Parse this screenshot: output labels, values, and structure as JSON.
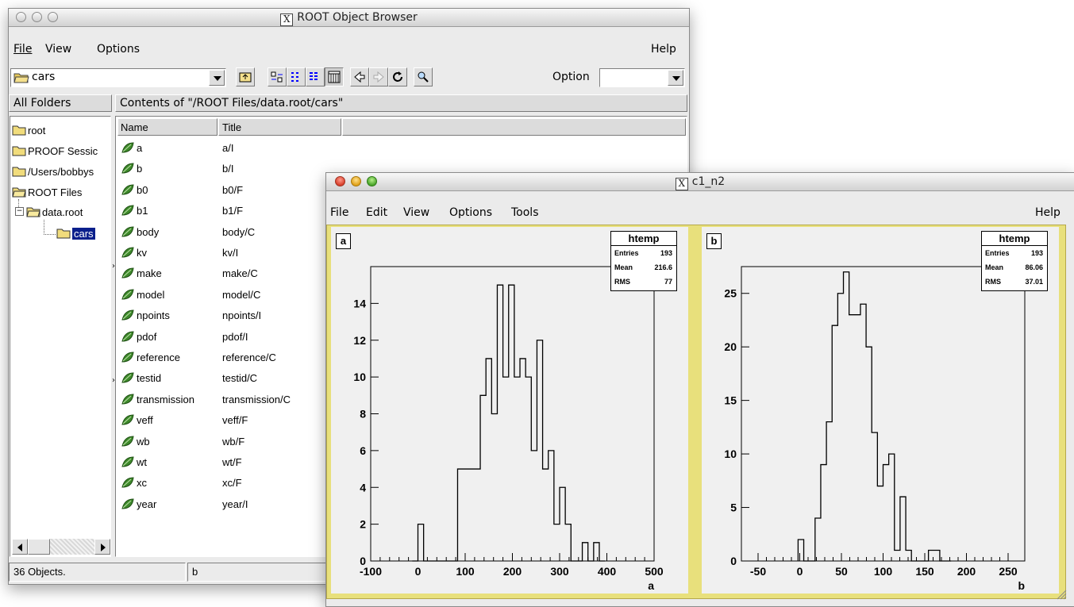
{
  "browser": {
    "title": "ROOT Object Browser",
    "menu": {
      "file": "File",
      "view": "View",
      "options": "Options",
      "help": "Help"
    },
    "location": "cars",
    "option_label": "Option",
    "option_value": "",
    "all_folders_label": "All Folders",
    "contents_label": "Contents of \"/ROOT Files/data.root/cars\"",
    "columns": {
      "name": "Name",
      "title": "Title"
    },
    "tree": [
      {
        "label": "root"
      },
      {
        "label": "PROOF Sessic"
      },
      {
        "label": "/Users/bobbys"
      },
      {
        "label": "ROOT Files"
      },
      {
        "label": "data.root"
      },
      {
        "label": "cars"
      }
    ],
    "items": [
      {
        "name": "a",
        "title": "a/I"
      },
      {
        "name": "b",
        "title": "b/I"
      },
      {
        "name": "b0",
        "title": "b0/F"
      },
      {
        "name": "b1",
        "title": "b1/F"
      },
      {
        "name": "body",
        "title": "body/C"
      },
      {
        "name": "kv",
        "title": "kv/I"
      },
      {
        "name": "make",
        "title": "make/C"
      },
      {
        "name": "model",
        "title": "model/C"
      },
      {
        "name": "npoints",
        "title": "npoints/I"
      },
      {
        "name": "pdof",
        "title": "pdof/I"
      },
      {
        "name": "reference",
        "title": "reference/C"
      },
      {
        "name": "testid",
        "title": "testid/C"
      },
      {
        "name": "transmission",
        "title": "transmission/C"
      },
      {
        "name": "veff",
        "title": "veff/F"
      },
      {
        "name": "wb",
        "title": "wb/F"
      },
      {
        "name": "wt",
        "title": "wt/F"
      },
      {
        "name": "xc",
        "title": "xc/F"
      },
      {
        "name": "year",
        "title": "year/I"
      }
    ],
    "status_count": "36 Objects.",
    "status_selected": "b"
  },
  "canvas": {
    "title": "c1_n2",
    "menu": {
      "file": "File",
      "edit": "Edit",
      "view": "View",
      "options": "Options",
      "tools": "Tools",
      "help": "Help"
    },
    "pad_a": {
      "label": "a",
      "stats": {
        "name": "htemp",
        "entries_label": "Entries",
        "entries": "193",
        "mean_label": "Mean",
        "mean": "216.6",
        "rms_label": "RMS",
        "rms": "77"
      }
    },
    "pad_b": {
      "label": "b",
      "stats": {
        "name": "htemp",
        "entries_label": "Entries",
        "entries": "193",
        "mean_label": "Mean",
        "mean": "86.06",
        "rms_label": "RMS",
        "rms": "37.01"
      }
    }
  },
  "chart_data": [
    {
      "type": "histogram",
      "xlabel": "a",
      "xlim": [
        -100,
        500
      ],
      "ylim": [
        0,
        16
      ],
      "xticks": [
        -100,
        0,
        100,
        200,
        300,
        400,
        500
      ],
      "yticks": [
        0,
        2,
        4,
        6,
        8,
        10,
        12,
        14
      ],
      "bin_width": 12,
      "bin_start": -12,
      "values": [
        0,
        2,
        0,
        0,
        0,
        0,
        0,
        0,
        5,
        5,
        5,
        5,
        9,
        11,
        8,
        15,
        10,
        15,
        10,
        11,
        10,
        6,
        12,
        5,
        6,
        2,
        4,
        2,
        0,
        0,
        1,
        0,
        1,
        0
      ]
    },
    {
      "type": "histogram",
      "xlabel": "b",
      "xlim": [
        -70,
        270
      ],
      "ylim": [
        0,
        27.5
      ],
      "xticks": [
        -50,
        0,
        50,
        100,
        150,
        200,
        250
      ],
      "yticks": [
        0,
        5,
        10,
        15,
        20,
        25
      ],
      "bin_width": 6.8,
      "bin_start": -2,
      "values": [
        2,
        0,
        0,
        4,
        9,
        13,
        22,
        25,
        27,
        23,
        23,
        24,
        20,
        12,
        7,
        9,
        10,
        1,
        6,
        1,
        0,
        0,
        0,
        1,
        1,
        0,
        0
      ]
    }
  ]
}
